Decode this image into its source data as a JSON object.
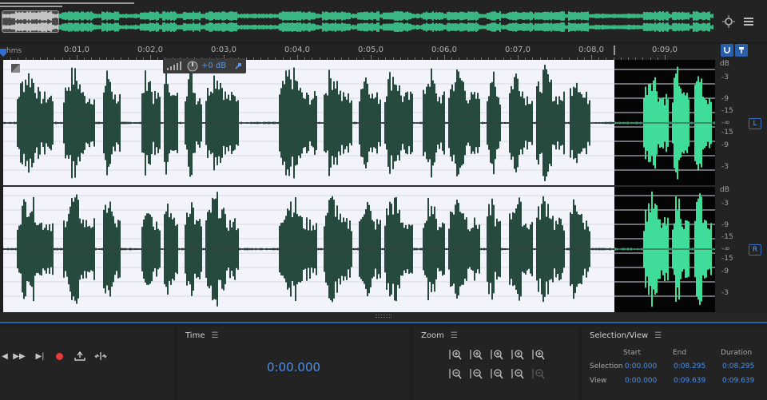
{
  "ruler": {
    "unit_label": "hms",
    "ticks": [
      "0:01,0",
      "0:02,0",
      "0:03,0",
      "0:04,0",
      "0:05,0",
      "0:06,0",
      "0:07,0",
      "0:08,0",
      "0:09,0"
    ]
  },
  "hud": {
    "gain": "+0 dB"
  },
  "db_scale": {
    "unit": "dB",
    "labels": [
      "-3",
      "-9",
      "-15",
      "-∞",
      "-15",
      "-9",
      "-3"
    ]
  },
  "channels": {
    "left": "L",
    "right": "R"
  },
  "time_panel": {
    "title": "Time",
    "value": "0:00.000"
  },
  "zoom_panel": {
    "title": "Zoom"
  },
  "selection_view": {
    "title": "Selection/View",
    "headers": [
      "Start",
      "End",
      "Duration"
    ],
    "rows": [
      {
        "label": "Selection",
        "start": "0:00.000",
        "end": "0:08.295",
        "duration": "0:08.295"
      },
      {
        "label": "View",
        "start": "0:00.000",
        "end": "0:09.639",
        "duration": "0:09.639"
      }
    ]
  },
  "colors": {
    "selection_bg": "#f3f3fb",
    "selected_wave": "#274a3f",
    "unselected_wave": "#3fdc9a",
    "accent": "#4a8fef"
  },
  "audio": {
    "view_duration_s": 9.639,
    "selection_end_s": 8.295
  }
}
